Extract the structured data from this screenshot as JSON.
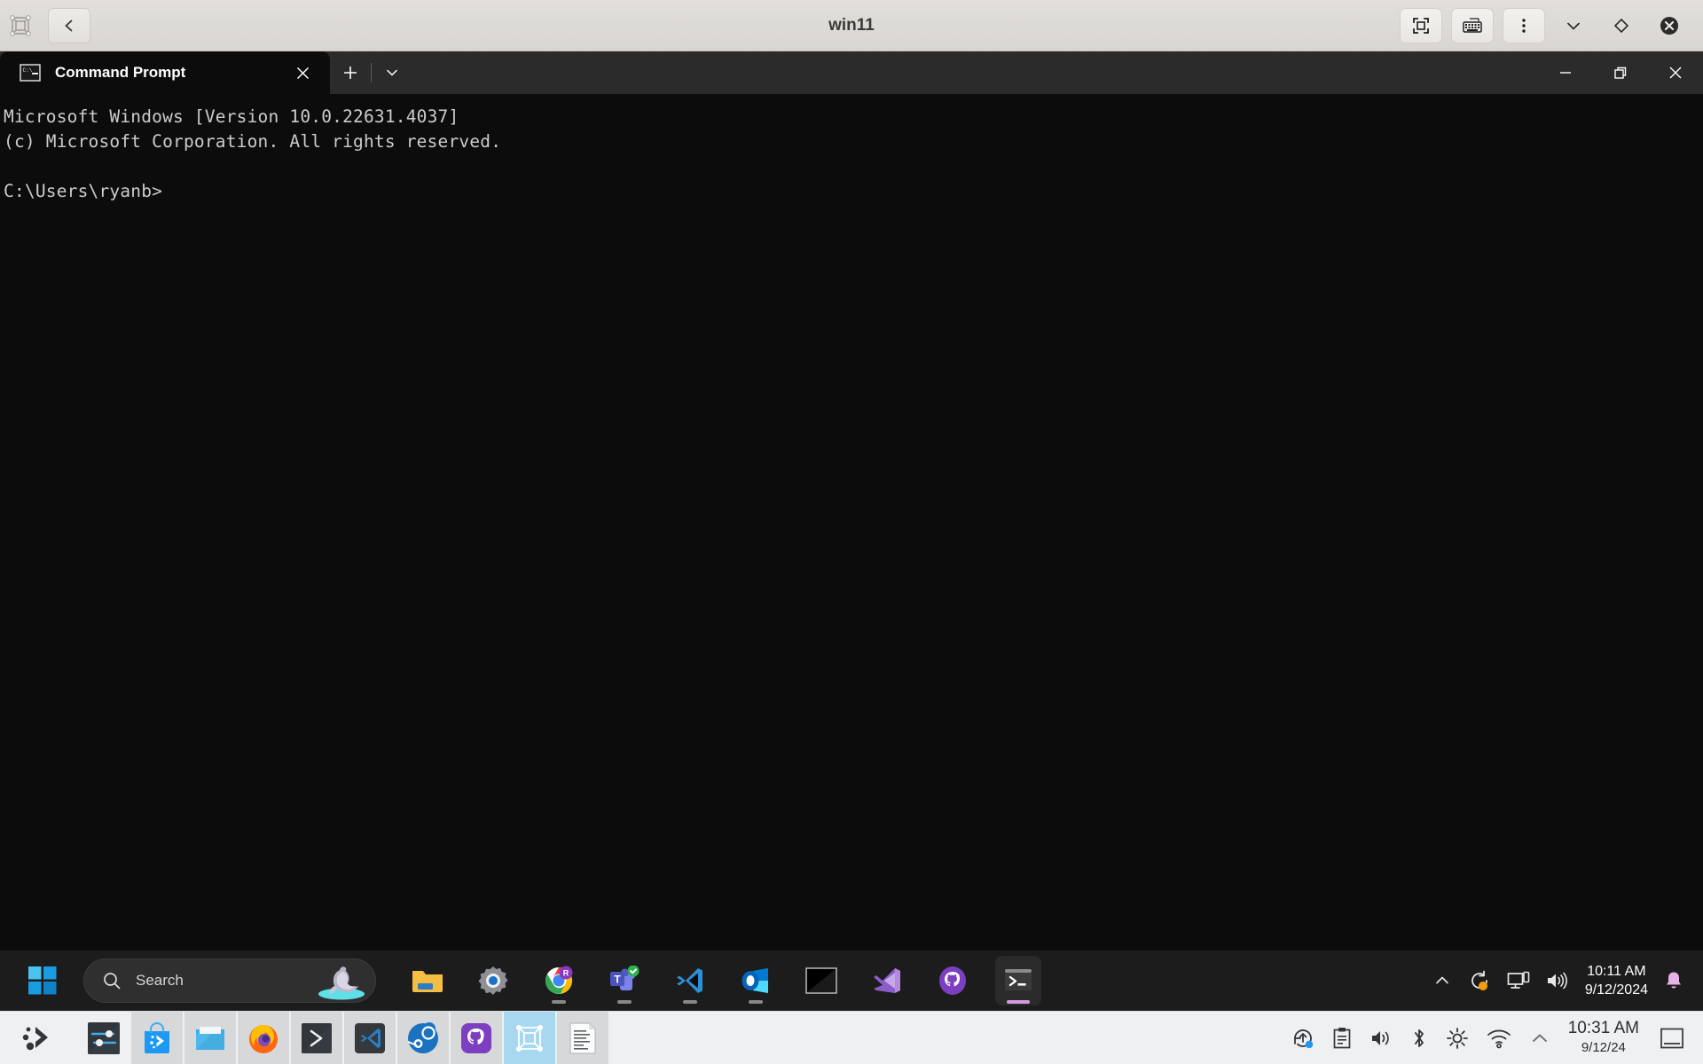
{
  "vbox_window": {
    "title": "win11",
    "logo_icon": "virtualbox-icon",
    "back_button_icon": "chevron-left-icon",
    "controls": [
      {
        "name": "fullscreen-button",
        "icon": "fit-to-screen-icon"
      },
      {
        "name": "keyboard-button",
        "icon": "keyboard-icon"
      },
      {
        "name": "menu-button",
        "icon": "three-dots-vertical-icon"
      },
      {
        "name": "minimize-button",
        "icon": "chevron-down-icon"
      },
      {
        "name": "restore-button",
        "icon": "diamond-icon"
      },
      {
        "name": "close-button",
        "icon": "close-circle-icon"
      }
    ]
  },
  "terminal": {
    "tab": {
      "title": "Command Prompt",
      "icon": "command-prompt-icon",
      "close_icon": "close-icon"
    },
    "new_tab_icon": "plus-icon",
    "tab_dropdown_icon": "chevron-down-icon",
    "window_controls": [
      {
        "name": "minimize-button",
        "icon": "minimize-icon"
      },
      {
        "name": "restore-button",
        "icon": "restore-icon"
      },
      {
        "name": "close-button",
        "icon": "close-icon"
      }
    ],
    "output_lines": [
      "Microsoft Windows [Version 10.0.22631.4037]",
      "(c) Microsoft Corporation. All rights reserved.",
      "",
      "C:\\Users\\ryanb>"
    ],
    "background_color": "#0c0c0c",
    "tabstrip_color": "#2b2b2b",
    "text_color": "#cccccc"
  },
  "windows_taskbar": {
    "start_button": {
      "name": "start-button",
      "icon": "windows-logo-icon"
    },
    "search": {
      "placeholder": "Search",
      "icon": "search-icon",
      "decoration_icon": "dolphin-icon"
    },
    "apps": [
      {
        "name": "file-explorer",
        "icon": "folder-icon",
        "running": false,
        "active": false
      },
      {
        "name": "settings",
        "icon": "gear-icon",
        "running": false,
        "active": false
      },
      {
        "name": "google-chrome",
        "icon": "chrome-icon",
        "running": true,
        "active": false,
        "badge": "R"
      },
      {
        "name": "microsoft-teams",
        "icon": "teams-icon",
        "running": true,
        "active": false,
        "badge": "check"
      },
      {
        "name": "visual-studio-code",
        "icon": "vscode-icon",
        "running": true,
        "active": false
      },
      {
        "name": "outlook",
        "icon": "outlook-icon",
        "running": true,
        "active": false
      },
      {
        "name": "console-window",
        "icon": "black-terminal-icon",
        "running": false,
        "active": false
      },
      {
        "name": "visual-studio",
        "icon": "visual-studio-icon",
        "running": false,
        "active": false
      },
      {
        "name": "github-desktop",
        "icon": "github-icon",
        "running": false,
        "active": false
      },
      {
        "name": "windows-terminal",
        "icon": "windows-terminal-icon",
        "running": true,
        "active": true
      }
    ],
    "tray": [
      {
        "name": "show-hidden-icons",
        "icon": "chevron-up-icon"
      },
      {
        "name": "windows-update",
        "icon": "sync-icon",
        "badge_color": "#f59e0b"
      },
      {
        "name": "network",
        "icon": "monitor-network-icon"
      },
      {
        "name": "volume",
        "icon": "speaker-icon"
      }
    ],
    "clock": {
      "time": "10:11 AM",
      "date": "9/12/2024"
    },
    "notifications": {
      "name": "notification-bell",
      "icon": "bell-icon",
      "color": "#e6b3e6"
    },
    "background_color": "#1c1c1c"
  },
  "host_panel": {
    "launcher": {
      "name": "kde-application-launcher",
      "icon": "kde-logo-icon"
    },
    "tasks": [
      {
        "name": "system-settings",
        "icon": "sliders-icon",
        "state": "normal"
      },
      {
        "name": "discover-store",
        "icon": "shopping-bag-icon",
        "state": "normal"
      },
      {
        "name": "dolphin-files",
        "icon": "folder-icon",
        "state": "normal"
      },
      {
        "name": "firefox",
        "icon": "firefox-icon",
        "state": "normal"
      },
      {
        "name": "konsole",
        "icon": "terminal-prompt-icon",
        "state": "normal"
      },
      {
        "name": "visual-studio-code",
        "icon": "vscode-icon",
        "state": "normal"
      },
      {
        "name": "steam",
        "icon": "steam-icon",
        "state": "normal"
      },
      {
        "name": "github-desktop",
        "icon": "github-icon",
        "state": "normal"
      },
      {
        "name": "virtualbox",
        "icon": "virtualbox-icon",
        "state": "selected"
      },
      {
        "name": "text-document",
        "icon": "document-icon",
        "state": "normal"
      }
    ],
    "tray": [
      {
        "name": "software-update",
        "icon": "update-arrow-icon",
        "badge_color": "#2196f3"
      },
      {
        "name": "clipboard",
        "icon": "clipboard-icon"
      },
      {
        "name": "volume",
        "icon": "speaker-icon"
      },
      {
        "name": "bluetooth",
        "icon": "bluetooth-icon"
      },
      {
        "name": "brightness",
        "icon": "sun-icon"
      },
      {
        "name": "wifi",
        "icon": "wifi-icon"
      },
      {
        "name": "show-hidden",
        "icon": "chevron-up-icon"
      }
    ],
    "clock": {
      "time": "10:31 AM",
      "date": "9/12/24"
    },
    "show_desktop": {
      "name": "show-desktop-button",
      "icon": "desktop-icon"
    },
    "background_color": "#eff0f1"
  }
}
